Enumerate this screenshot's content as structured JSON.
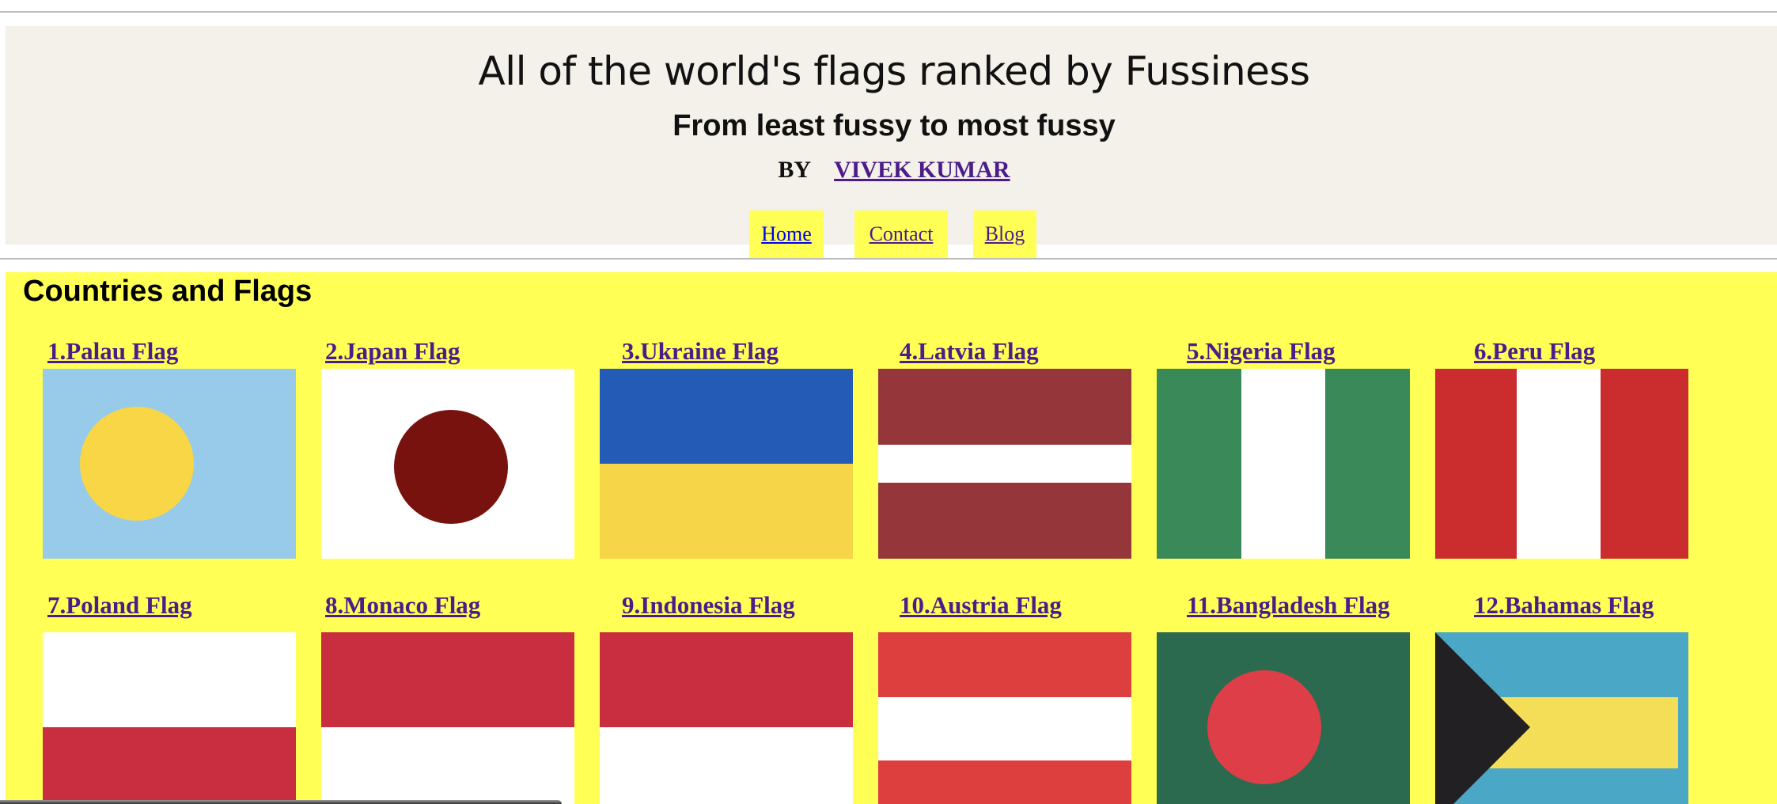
{
  "header": {
    "title": "All of the world's flags ranked by Fussiness",
    "subtitle": "From least fussy to most fussy",
    "by_label": "BY",
    "author": "VIVEK KUMAR"
  },
  "nav": {
    "home": "Home",
    "contact": "Contact",
    "blog": "Blog"
  },
  "section_title": "Countries and Flags",
  "flags": [
    {
      "label": "1.Palau Flag",
      "icon": "palau-flag-image"
    },
    {
      "label": "2.Japan Flag",
      "icon": "japan-flag-image"
    },
    {
      "label": "3.Ukraine Flag",
      "icon": "ukraine-flag-image"
    },
    {
      "label": "4.Latvia Flag",
      "icon": "latvia-flag-image"
    },
    {
      "label": "5.Nigeria Flag",
      "icon": "nigeria-flag-image"
    },
    {
      "label": "6.Peru Flag",
      "icon": "peru-flag-image"
    },
    {
      "label": "7.Poland Flag",
      "icon": "poland-flag-image"
    },
    {
      "label": "8.Monaco Flag",
      "icon": "monaco-flag-image"
    },
    {
      "label": "9.Indonesia Flag",
      "icon": "indonesia-flag-image"
    },
    {
      "label": "10.Austria Flag",
      "icon": "austria-flag-image"
    },
    {
      "label": "11.Bangladesh Flag",
      "icon": "bangladesh-flag-image"
    },
    {
      "label": "12.Bahamas Flag",
      "icon": "bahamas-flag-image"
    }
  ],
  "colors": {
    "header_bg": "#f4f0ea",
    "main_bg": "#ffff55",
    "nav_bg": "#ffff55",
    "link_visited": "#4b1c8a",
    "link": "#0000ee"
  }
}
